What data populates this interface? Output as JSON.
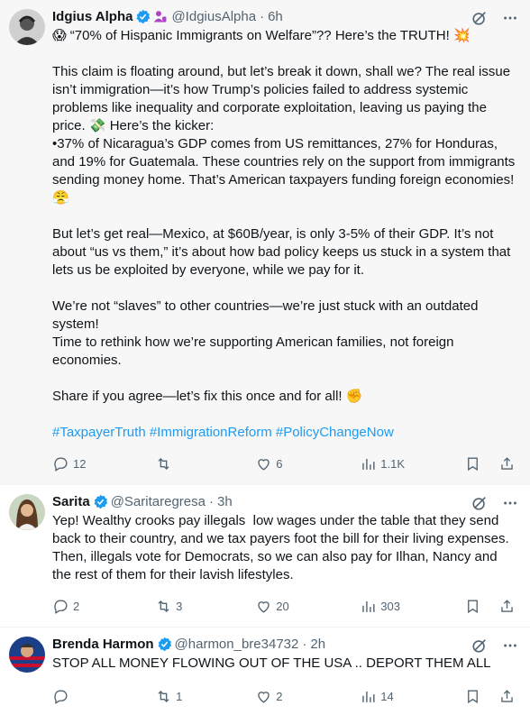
{
  "tweets": [
    {
      "name": "Idgius Alpha",
      "handle": "@IdgiusAlpha",
      "time": "6h",
      "text": "😱 “70% of Hispanic Immigrants on Welfare”?? Here’s the TRUTH! 💥\n\nThis claim is floating around, but let’s break it down, shall we? The real issue isn’t immigration—it’s how Trump’s policies failed to address systemic problems like inequality and corporate exploitation, leaving us paying the price. 💸 Here’s the kicker:\n•37% of Nicaragua’s GDP comes from US remittances, 27% for Honduras, and 19% for Guatemala. These countries rely on the support from immigrants sending money home. That’s American taxpayers funding foreign economies! 😤\n\nBut let’s get real—Mexico, at $60B/year, is only 3-5% of their GDP. It’s not about “us vs them,” it’s about how bad policy keeps us stuck in a system that lets us be exploited by everyone, while we pay for it.\n\nWe’re not “slaves” to other countries—we’re just stuck with an outdated system!\nTime to rethink how we’re supporting American families, not foreign economies.\n\nShare if you agree—let’s fix this once and for all! ✊",
      "hashtags": "#TaxpayerTruth #ImmigrationReform #PolicyChangeNow",
      "replies": "12",
      "retweets": "",
      "likes": "6",
      "views": "1.1K"
    },
    {
      "name": "Sarita",
      "handle": "@Saritaregresa",
      "time": "3h",
      "text": "Yep! Wealthy crooks pay illegals  low wages under the table that they send back to their country, and we tax payers foot the bill for their living expenses. Then, illegals vote for Democrats, so we can also pay for Ilhan, Nancy and the rest of them for their lavish lifestyles.",
      "replies": "2",
      "retweets": "3",
      "likes": "20",
      "views": "303"
    },
    {
      "name": "Brenda Harmon",
      "handle": "@harmon_bre34732",
      "time": "2h",
      "text": "STOP ALL MONEY FLOWING OUT OF THE USA .. DEPORT THEM ALL",
      "replies": "",
      "retweets": "1",
      "likes": "2",
      "views": "14"
    }
  ],
  "icons": [
    "verified-badge-icon",
    "purple-badge-icon",
    "grok-icon",
    "more-icon",
    "reply-icon",
    "retweet-icon",
    "like-icon",
    "views-icon",
    "bookmark-icon",
    "share-icon"
  ],
  "colors": {
    "accent": "#1d9bf0",
    "muted": "#536471",
    "text": "#0f1419"
  }
}
